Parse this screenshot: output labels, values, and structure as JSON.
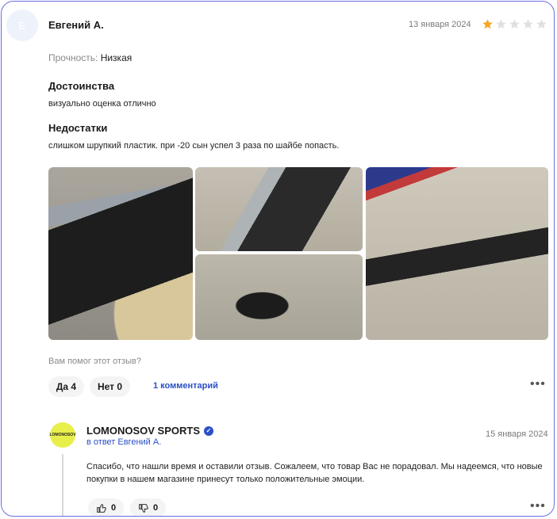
{
  "review": {
    "avatar_letter": "Е",
    "author": "Евгений А.",
    "date": "13 января 2024",
    "rating": 1,
    "max_rating": 5,
    "strength_label": "Прочность:",
    "strength_value": "Низкая",
    "pros_heading": "Достоинства",
    "pros_text": "визуально оценка отлично",
    "cons_heading": "Недостатки",
    "cons_text": "слишком шрупкий пластик. при -20 сын успел 3 раза по шайбе попасть.",
    "photos": [
      "stick-blade-edge-photo",
      "blade-closeup-photo",
      "blade-curve-photo",
      "cracked-blade-photo"
    ],
    "helpful_question": "Вам помог этот отзыв?",
    "yes_label": "Да 4",
    "no_label": "Нет 0",
    "comments_link": "1 комментарий"
  },
  "reply": {
    "shop_name": "LOMONOSOV SPORTS",
    "logo_text": "LOMONOSOV",
    "reply_to": "в ответ Евгений А.",
    "date": "15 января 2024",
    "text": "Спасибо, что нашли время и оставили отзыв. Сожалеем, что товар Вас не порадовал. Мы надеемся, что новые покупки в нашем магазине принесут только положительные эмоции.",
    "likes": "0",
    "dislikes": "0"
  },
  "colors": {
    "accent": "#2b4fc7",
    "star_filled": "#f5a623",
    "star_empty": "#e0e0e0",
    "border": "#6b6fe0"
  }
}
